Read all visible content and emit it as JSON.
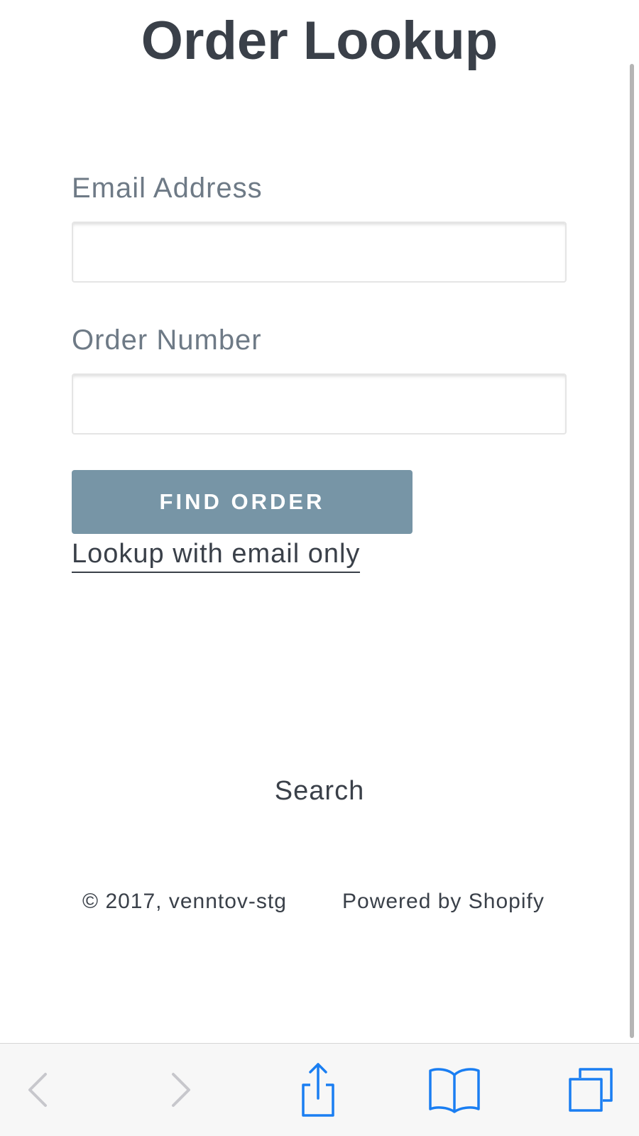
{
  "page": {
    "title": "Order Lookup"
  },
  "form": {
    "email_label": "Email Address",
    "email_value": "",
    "email_placeholder": "",
    "order_label": "Order Number",
    "order_value": "",
    "order_placeholder": "",
    "submit_label": "FIND ORDER",
    "email_only_link": "Lookup with email only"
  },
  "footer": {
    "search_link": "Search",
    "copyright": "© 2017, venntov-stg",
    "powered_by": "Powered by Shopify"
  },
  "browser_toolbar": {
    "icons": [
      "chevron-left-icon",
      "chevron-right-icon",
      "share-icon",
      "bookmarks-icon",
      "tabs-icon"
    ],
    "active_color": "#1a7ef2",
    "disabled_color": "#c7c7cc"
  },
  "colors": {
    "title": "#3a4049",
    "label": "#6e7a86",
    "button": "#7795a6",
    "text": "#3a4049"
  }
}
